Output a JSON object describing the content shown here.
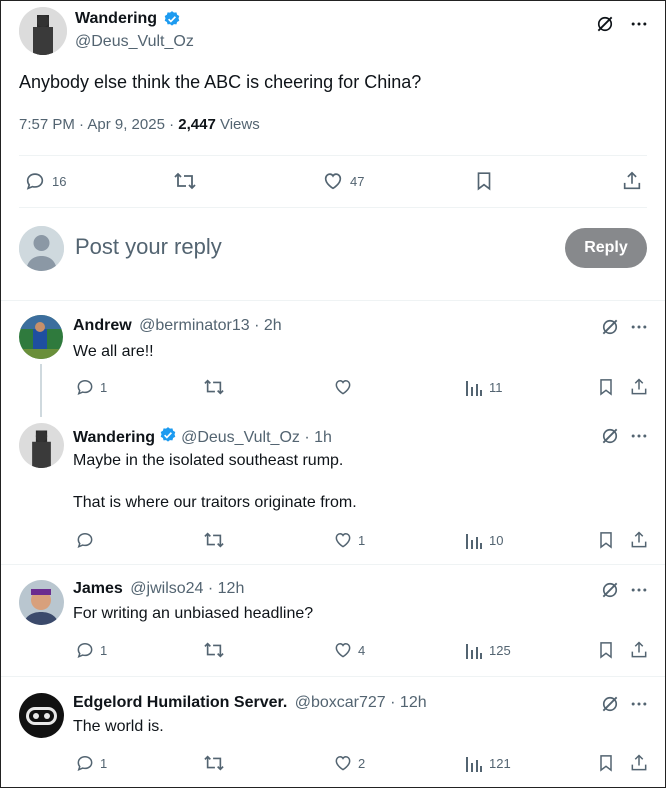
{
  "main_post": {
    "name": "Wandering",
    "handle": "@Deus_Vult_Oz",
    "text": "Anybody else think the ABC is cheering for China?",
    "time": "7:57 PM · Apr 9, 2025 · ",
    "views_count": "2,447",
    "views_label": " Views",
    "replies": "16",
    "likes": "47"
  },
  "reply_box": {
    "placeholder": "Post your reply",
    "button": "Reply"
  },
  "replies": [
    {
      "name": "Andrew",
      "handle": "@berminator13 · 2h",
      "lines": [
        "We all are!!"
      ],
      "reply_count": "1",
      "retweets": "",
      "likes": "",
      "views": "11"
    },
    {
      "name": "Wandering",
      "handle": "@Deus_Vult_Oz · 1h",
      "lines": [
        "Maybe in the isolated southeast rump.",
        "That is where our traitors originate from."
      ],
      "reply_count": "",
      "retweets": "",
      "likes": "1",
      "views": "10"
    },
    {
      "name": "James",
      "handle": "@jwilso24 · 12h",
      "lines": [
        "For writing an unbiased headline?"
      ],
      "reply_count": "1",
      "retweets": "",
      "likes": "4",
      "views": "125"
    },
    {
      "name": "Edgelord Humilation Server.",
      "handle": "@boxcar727 · 12h",
      "lines": [
        "The world is."
      ],
      "reply_count": "1",
      "retweets": "",
      "likes": "2",
      "views": "121"
    }
  ],
  "colors": {
    "verified": "#1d9bf0",
    "text": "#0f1419",
    "muted": "#536471",
    "reply_button": "#87898c"
  }
}
